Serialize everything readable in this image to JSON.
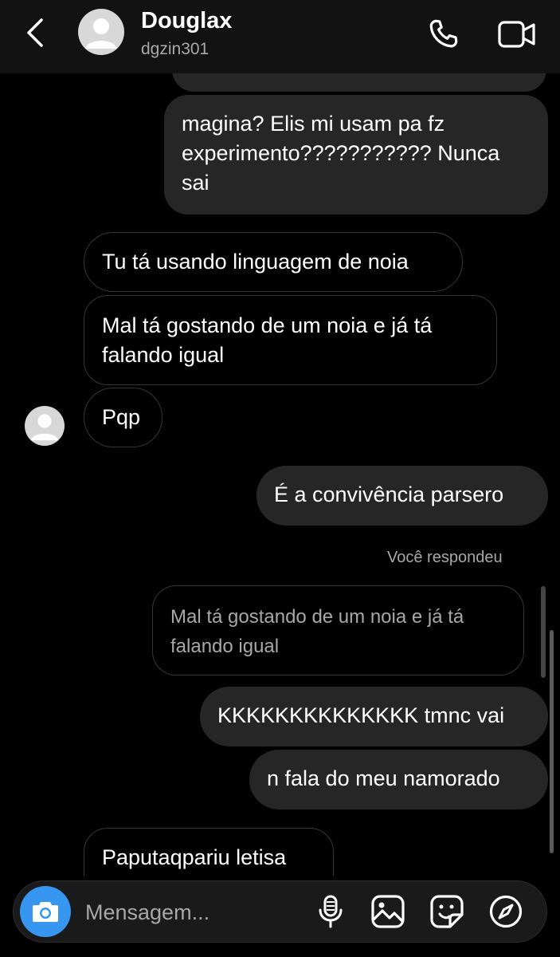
{
  "header": {
    "name": "Douglax",
    "username": "dgzin301"
  },
  "messages": {
    "m1": "magina? Elis mi usam pa fz\nexperimento??????????? Nunca\nsai",
    "m2": "Tu tá usando linguagem de noia",
    "m3": "Mal tá gostando de um noia e já tá\nfalando igual",
    "m4": "Pqp",
    "m5": "É a convivência parsero",
    "reply_label": "Você respondeu",
    "reply_quote": "Mal tá gostando de um noia e já tá\nfalando igual",
    "m6": "KKKKKKKKKKKKKK tmnc vai",
    "m7": "n fala do meu namorado",
    "m8": "Paputaqpariu letisa"
  },
  "composer": {
    "placeholder": "Mensagem..."
  },
  "icons": {
    "back": "chevron-left-icon",
    "call": "phone-icon",
    "video": "video-camera-icon",
    "camera": "camera-icon",
    "mic": "microphone-icon",
    "gallery": "image-icon",
    "sticker": "sticker-icon",
    "explore": "compass-icon"
  },
  "colors": {
    "accent": "#3797f0",
    "bubble_out": "#262626",
    "background": "#000000"
  }
}
